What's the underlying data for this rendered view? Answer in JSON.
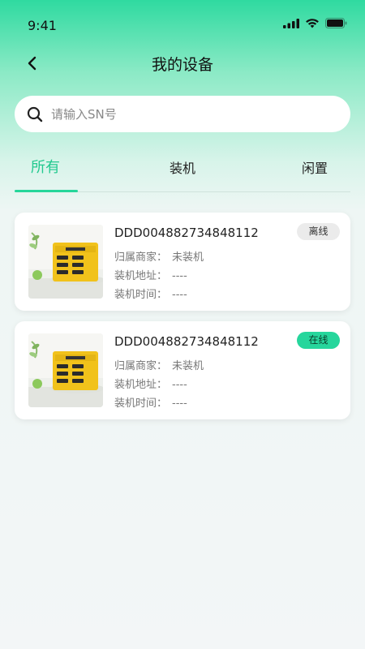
{
  "status_bar": {
    "time": "9:41"
  },
  "nav": {
    "title": "我的设备"
  },
  "search": {
    "placeholder": "请输入SN号",
    "value": ""
  },
  "tabs": [
    {
      "label": "所有",
      "active": true
    },
    {
      "label": "装机",
      "active": false
    },
    {
      "label": "闲置",
      "active": false
    }
  ],
  "devices": [
    {
      "id": "DDD004882734848112",
      "merchant_label": "归属商家：",
      "merchant_value": "未装机",
      "address_label": "装机地址：",
      "address_value": "----",
      "time_label": "装机时间：",
      "time_value": "----",
      "status": "离线"
    },
    {
      "id": "DDD004882734848112",
      "merchant_label": "归属商家：",
      "merchant_value": "未装机",
      "address_label": "装机地址：",
      "address_value": "----",
      "time_label": "装机时间：",
      "time_value": "----",
      "status": "在线"
    }
  ],
  "colors": {
    "accent": "#25d69a",
    "offline_badge": "#ebebeb",
    "online_badge": "#26d69c"
  }
}
